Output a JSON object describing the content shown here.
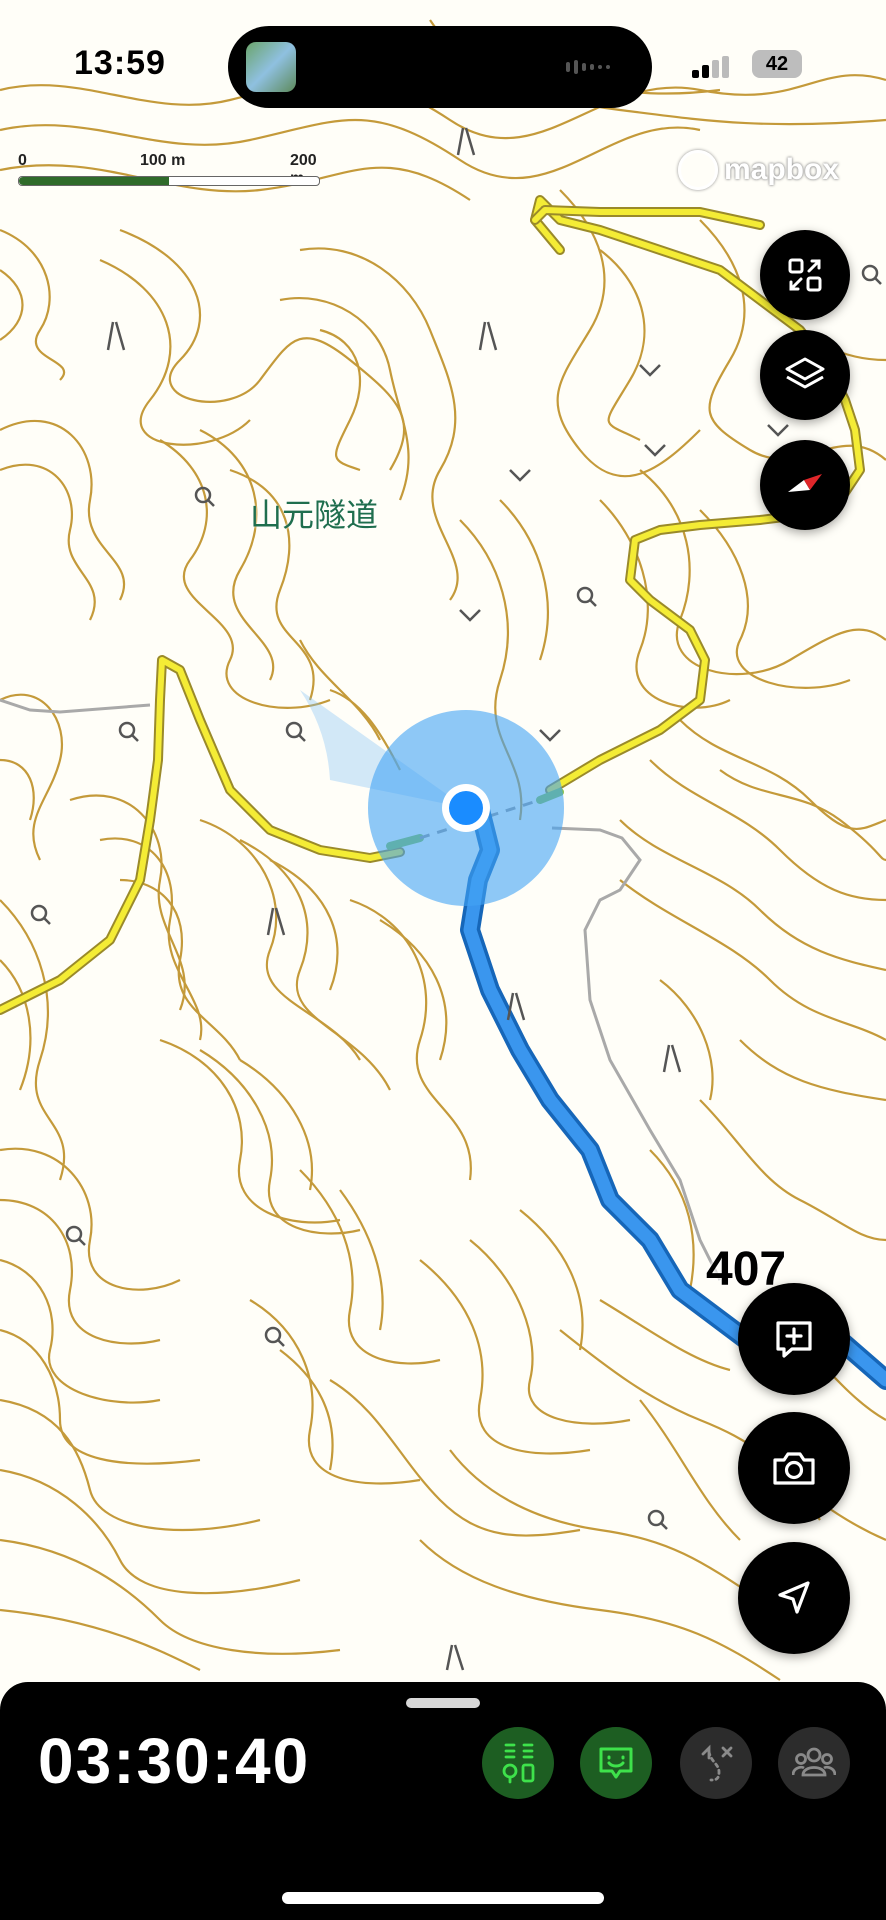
{
  "status_bar": {
    "time": "13:59",
    "battery": "42"
  },
  "map": {
    "scale": {
      "zero": "0",
      "mid": "100 m",
      "end": "200 m"
    },
    "attribution": "mapbox",
    "place_name": "山元隧道",
    "elevation_label": "407",
    "colors": {
      "contour": "#c49a3a",
      "road": "#f1e93a",
      "track": "#2e87e6",
      "location": "#1a8cff"
    }
  },
  "controls": {
    "expand": "expand-icon",
    "layers": "layers-icon",
    "compass": "compass-icon",
    "add_note": "add-note-icon",
    "camera": "camera-icon",
    "locate": "location-arrow-icon"
  },
  "bottom_sheet": {
    "elapsed_time": "03:30:40",
    "tools": [
      "route-markers-icon",
      "pin-chat-icon",
      "route-edit-icon",
      "group-icon"
    ]
  }
}
